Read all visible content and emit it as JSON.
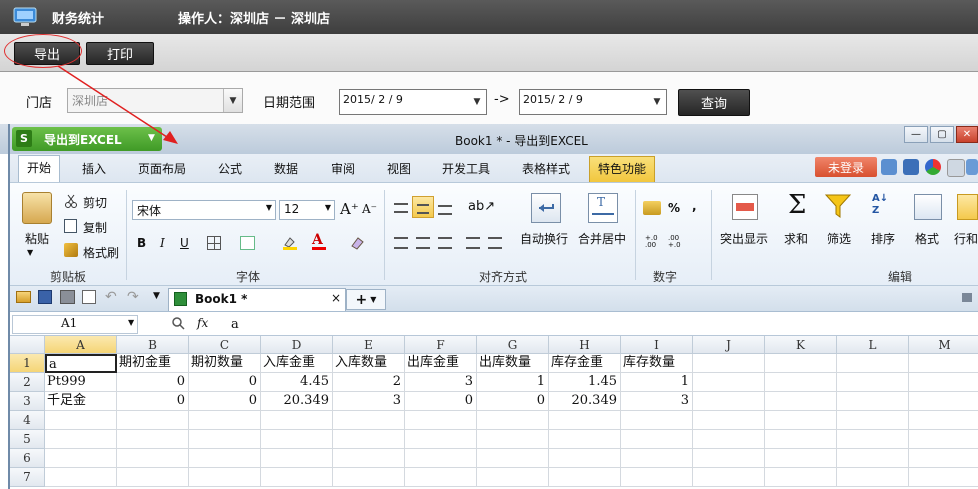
{
  "app": {
    "title": "财务统计",
    "operator": "操作人：深圳店 － 深圳店"
  },
  "toolbar": {
    "export_label": "导出",
    "print_label": "打印"
  },
  "filter": {
    "store_label": "门店",
    "store_value": "深圳店",
    "date_range_label": "日期范围",
    "date_from": "2015/ 2 / 9",
    "range_arrow": "->",
    "date_to": "2015/ 2 / 9",
    "query_label": "查询"
  },
  "excel": {
    "export_excel_label": "导出到EXCEL",
    "logo_letter": "S",
    "window_title": "Book1 * -   导出到EXCEL",
    "tabs": [
      "开始",
      "插入",
      "页面布局",
      "公式",
      "数据",
      "审阅",
      "视图",
      "开发工具",
      "表格样式"
    ],
    "special_tab": "特色功能",
    "login_label": "未登录",
    "ribbon": {
      "paste_label": "粘贴",
      "cut_label": "剪切",
      "copy_label": "复制",
      "format_painter_label": "格式刷",
      "clipboard_group": "剪贴板",
      "font_name": "宋体",
      "font_size": "12",
      "bold": "B",
      "italic": "I",
      "underline": "U",
      "font_group": "字体",
      "wrap_label": "自动换行",
      "merge_label": "合并居中",
      "align_group": "对齐方式",
      "percent": "%",
      "comma": ",",
      "number_group": "数字",
      "highlight_label": "突出显示",
      "sum_label": "求和",
      "filter_label": "筛选",
      "sort_label": "排序",
      "format_label": "格式",
      "rowcol_label": "行和",
      "edit_group": "编辑"
    },
    "doc_tab": "Book1 *",
    "doc_close": "×",
    "new_tab": "+",
    "name_box": "A1",
    "fx": "fx",
    "formula_value": "a",
    "columns": [
      "A",
      "B",
      "C",
      "D",
      "E",
      "F",
      "G",
      "H",
      "I",
      "J",
      "K",
      "L",
      "M"
    ],
    "rows": [
      "1",
      "2",
      "3",
      "4",
      "5",
      "6",
      "7"
    ],
    "cells": [
      [
        "a",
        "期初金重",
        "期初数量",
        "入库金重",
        "入库数量",
        "出库金重",
        "出库数量",
        "库存金重",
        "库存数量"
      ],
      [
        "Pt999",
        "0",
        "0",
        "4.45",
        "2",
        "3",
        "1",
        "1.45",
        "1"
      ],
      [
        "千足金",
        "0",
        "0",
        "20.349",
        "3",
        "0",
        "0",
        "20.349",
        "3"
      ]
    ]
  }
}
